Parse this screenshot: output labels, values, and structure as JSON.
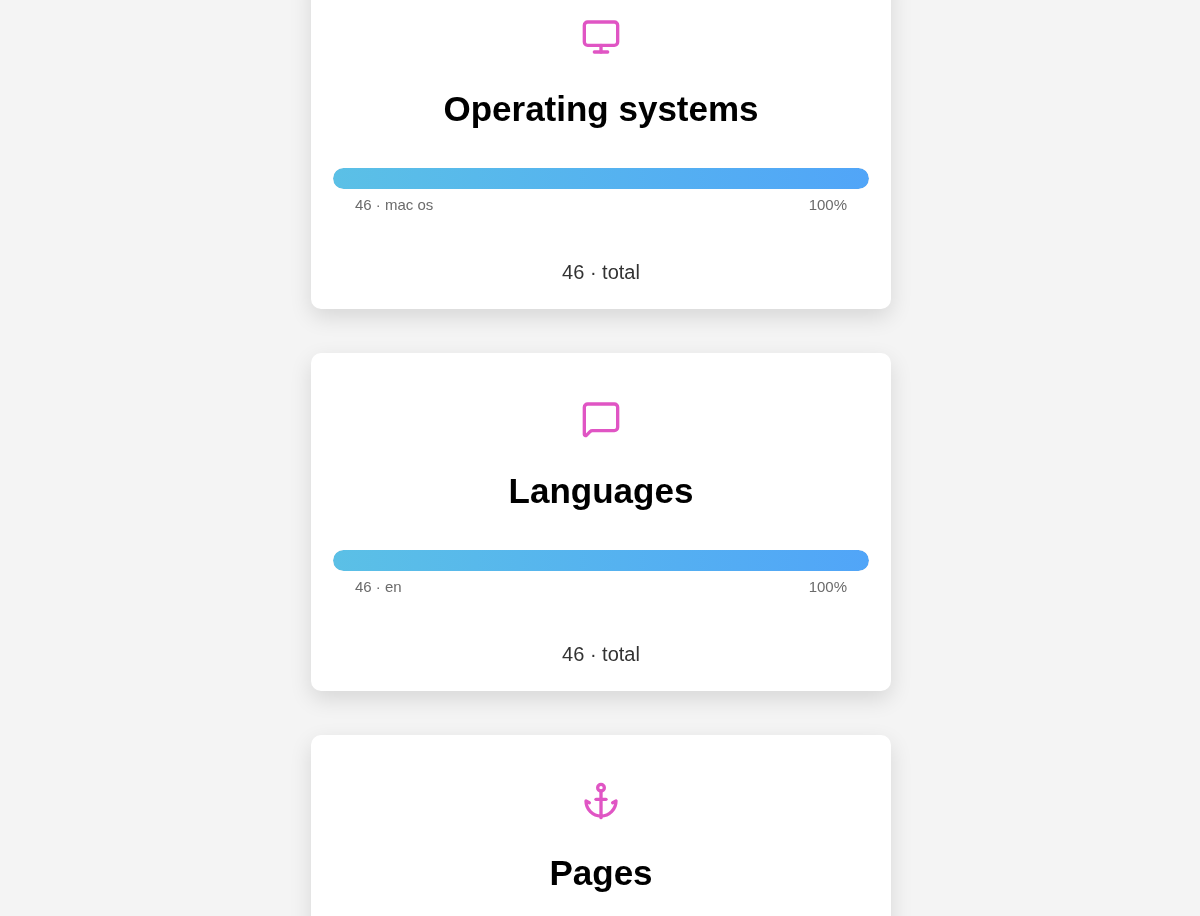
{
  "cards": [
    {
      "kind": "monitor",
      "title": "Operating systems",
      "bar": {
        "level": 1,
        "label": "46 · mac os",
        "percent": "100%"
      },
      "total": "46 · total"
    },
    {
      "kind": "message",
      "title": "Languages",
      "bar": {
        "level": 1,
        "label": "46 · en",
        "percent": "100%"
      },
      "total": "46 · total"
    },
    {
      "kind": "anchor",
      "title": "Pages"
    }
  ]
}
